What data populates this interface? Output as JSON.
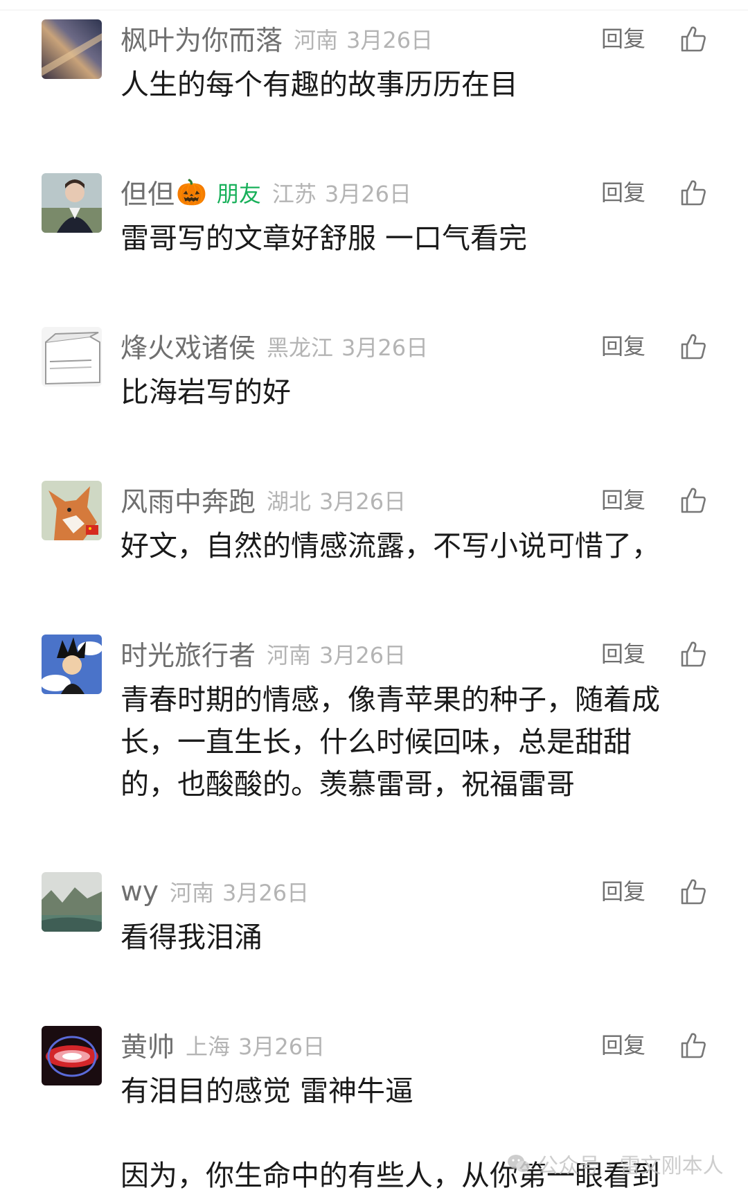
{
  "actions": {
    "reply_label": "回复"
  },
  "comments": [
    {
      "name": "枫叶为你而落",
      "location": "河南",
      "date": "3月26日",
      "text": "人生的每个有趣的故事历历在目"
    },
    {
      "name": "但但",
      "emoji": "🎃",
      "friend_badge": "朋友",
      "location": "江苏",
      "date": "3月26日",
      "text": "雷哥写的文章好舒服 一口气看完"
    },
    {
      "name": "烽火戏诸侯",
      "location": "黑龙江",
      "date": "3月26日",
      "text": "比海岩写的好"
    },
    {
      "name": "风雨中奔跑",
      "location": "湖北",
      "date": "3月26日",
      "text": "好文，自然的情感流露，不写小说可惜了，"
    },
    {
      "name": "时光旅行者",
      "location": "河南",
      "date": "3月26日",
      "text_lines": [
        "青春时期的情感，像青苹果的种子，随着成",
        "长，一直生长，什么时候回味，总是甜甜",
        "的，也酸酸的。羡慕雷哥，祝福雷哥"
      ]
    },
    {
      "name": "wy",
      "location": "河南",
      "date": "3月26日",
      "text": "看得我泪涌"
    },
    {
      "name": "黄帅",
      "location": "上海",
      "date": "3月26日",
      "text_lines": [
        "有泪目的感觉  雷神牛逼",
        "",
        "因为，你生命中的有些人，从你第一眼看到"
      ]
    }
  ],
  "watermark": {
    "label": "公众号 · 雷文刚本人"
  },
  "colors": {
    "friend": "#18b05a",
    "meta": "#b4b4b4",
    "name": "#6f6f6f",
    "text": "#1a1a1a"
  }
}
